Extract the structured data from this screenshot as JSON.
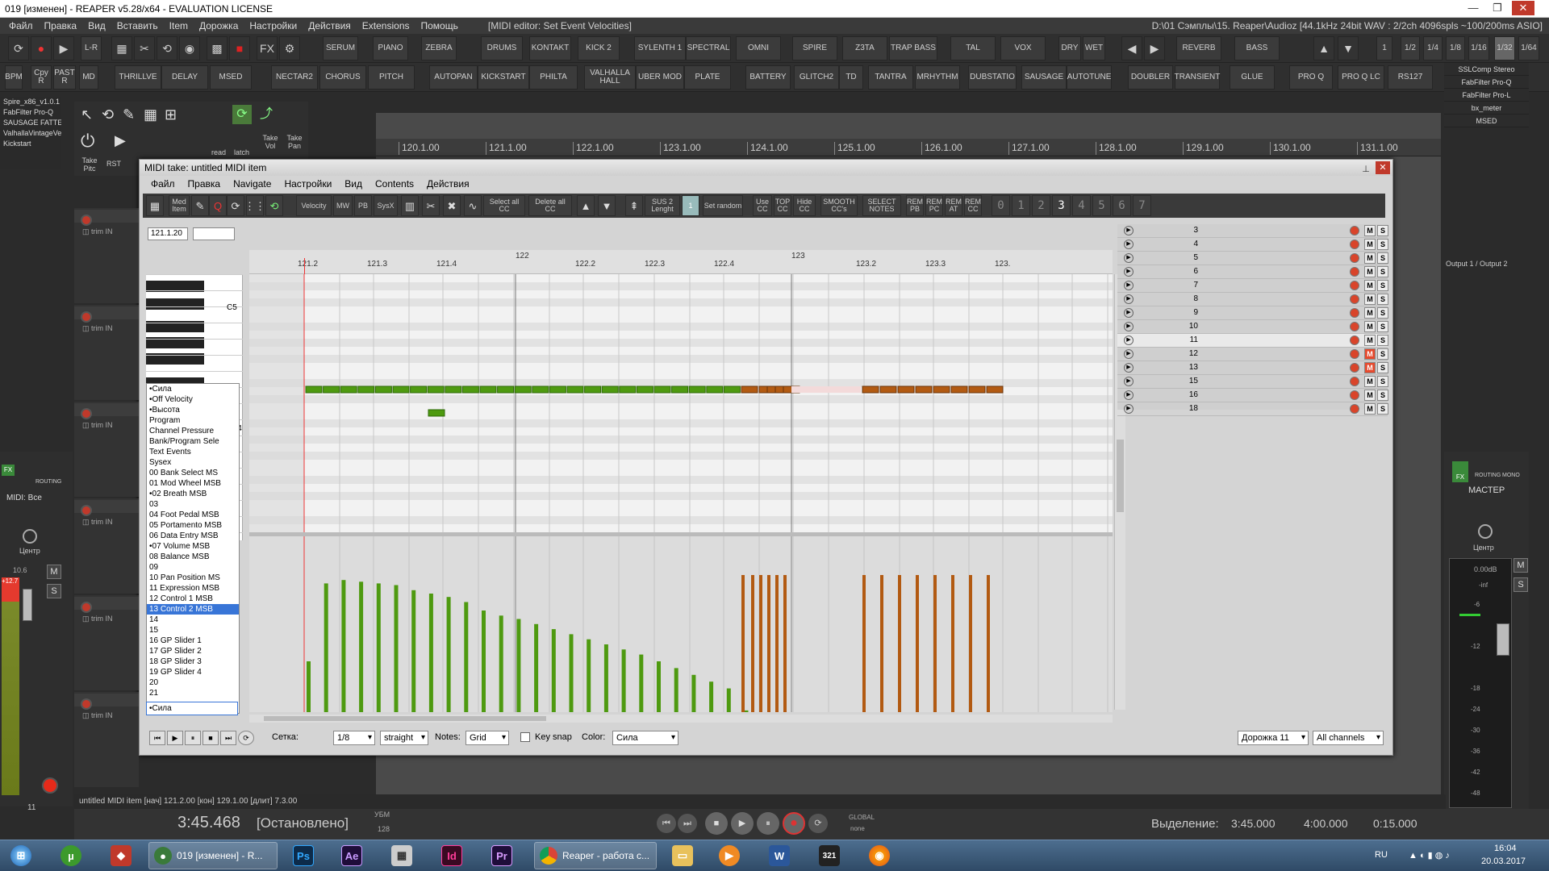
{
  "window": {
    "title": "019 [изменен] - REAPER v5.28/x64 - EVALUATION LICENSE",
    "menu": [
      "Файл",
      "Правка",
      "Вид",
      "Вставить",
      "Item",
      "Дорожка",
      "Настройки",
      "Действия",
      "Extensions",
      "Помощь"
    ],
    "editor_title": "[MIDI editor: Set Event Velocities]",
    "audio_info": "D:\\01 Сэмплы\\15. Reaper\\Audioz [44.1kHz 24bit WAV : 2/2ch 4096spls ~100/200ms ASIO]"
  },
  "toolbar1": {
    "labels": [
      "L-R",
      "SERUM",
      "PIANO",
      "ZEBRA",
      "DRUMS",
      "KONTAKT",
      "KICK 2",
      "SYLENTH 1",
      "SPECTRAL",
      "OMNI",
      "SPIRE",
      "Z3TA",
      "TRAP BASS",
      "TAL",
      "VOX",
      "DRY",
      "WET",
      "REVERB",
      "BASS",
      "1",
      "1/2",
      "1/4",
      "1/8",
      "1/16",
      "1/32",
      "1/64"
    ]
  },
  "toolbar2": {
    "labels": [
      "BPM",
      "Cpy R",
      "PAST R",
      "MD",
      "THRILLVE",
      "DELAY",
      "MSED",
      "NECTAR2",
      "CHORUS",
      "PITCH",
      "AUTOPAN",
      "KICKSTART",
      "PHILTA",
      "VALHALLA HALL",
      "UBER MOD",
      "PLATE",
      "BATTERY",
      "GLITCH2",
      "TD",
      "TANTRA",
      "MRHYTHM",
      "DUBSTATIO",
      "SAUSAGE",
      "AUTOTUNE",
      "DOUBLER",
      "TRANSIENT",
      "GLUE",
      "PRO Q",
      "PRO Q LC",
      "RS127"
    ]
  },
  "left_fx": [
    "Spire_x86_v1.0.1",
    "FabFilter Pro-Q",
    "SAUSAGE FATTE",
    "ValhallaVintageVe",
    "Kickstart"
  ],
  "right_fx": [
    "SSLComp Stereo",
    "FabFilter Pro-Q",
    "FabFilter Pro-L",
    "bx_meter",
    "MSED"
  ],
  "right_output": "Output 1 / Output 2",
  "tool3": [
    "read",
    "latch",
    "Take Vol",
    "Take Pan",
    "Take Pitc",
    "RST"
  ],
  "main_ruler": [
    "120.1.00",
    "121.1.00",
    "122.1.00",
    "123.1.00",
    "124.1.00",
    "125.1.00",
    "126.1.00",
    "127.1.00",
    "128.1.00",
    "129.1.00",
    "130.1.00",
    "131.1.00"
  ],
  "midi": {
    "title": "MIDI take: untitled MIDI item",
    "menu": [
      "Файл",
      "Правка",
      "Navigate",
      "Настройки",
      "Вид",
      "Contents",
      "Действия"
    ],
    "toolbar": [
      "Med Item",
      "Velocity",
      "MW",
      "PB",
      "SysX",
      "Select all CC",
      "Delete all CC",
      "SUS 2 Lenght",
      "1",
      "Set random",
      "Use CC",
      "TOP CC",
      "Hide CC",
      "SMOOTH CC's",
      "SELECT NOTES",
      "REM PB",
      "REM PC",
      "REM AT",
      "REM CC"
    ],
    "position": "121.1.20",
    "ruler": [
      "121.2",
      "121.3",
      "121.4",
      "122",
      "122.2",
      "122.3",
      "122.4",
      "123",
      "123.2",
      "123.3",
      "123."
    ],
    "key_label": "C5",
    "key_label2": "C4",
    "cc_list": [
      "•Сила",
      "•Off Velocity",
      "•Высота",
      "Program",
      "Channel Pressure",
      "Bank/Program Sele",
      "Text Events",
      "Sysex",
      "00 Bank Select MS",
      "01 Mod Wheel MSB",
      "•02 Breath MSB",
      "03",
      "04 Foot Pedal MSB",
      "05 Portamento MSB",
      "06 Data Entry MSB",
      "•07 Volume MSB",
      "08 Balance MSB",
      "09",
      "10 Pan Position MS",
      "11 Expression MSB",
      "12 Control 1 MSB",
      "13 Control 2 MSB",
      "14",
      "15",
      "16 GP Slider 1",
      "17 GP Slider 2",
      "18 GP Slider 3",
      "19 GP Slider 4",
      "20",
      "21"
    ],
    "cc_selected_index": 21,
    "cc_current": "•Сила",
    "tracks": [
      {
        "n": "3",
        "active": false,
        "muted": false
      },
      {
        "n": "4",
        "active": false,
        "muted": false
      },
      {
        "n": "5",
        "active": false,
        "muted": false
      },
      {
        "n": "6",
        "active": false,
        "muted": false
      },
      {
        "n": "7",
        "active": false,
        "muted": false
      },
      {
        "n": "8",
        "active": false,
        "muted": false
      },
      {
        "n": "9",
        "active": false,
        "muted": false
      },
      {
        "n": "10",
        "active": false,
        "muted": false
      },
      {
        "n": "11",
        "active": true,
        "muted": false
      },
      {
        "n": "12",
        "active": false,
        "muted": true
      },
      {
        "n": "13",
        "active": false,
        "muted": true
      },
      {
        "n": "15",
        "active": false,
        "muted": false
      },
      {
        "n": "16",
        "active": false,
        "muted": false
      },
      {
        "n": "18",
        "active": false,
        "muted": false
      }
    ],
    "m_label": "M",
    "s_label": "S",
    "bottom": {
      "grid_label": "Сетка:",
      "grid_value": "1/8",
      "swing_value": "straight",
      "notes_label": "Notes:",
      "notes_value": "Grid",
      "keysnap_label": "Key snap",
      "color_label": "Color:",
      "color_value": "Сила",
      "track_value": "Дорожка 11",
      "channel_value": "All channels"
    },
    "green_velocities": [
      30,
      76,
      78,
      77,
      76,
      75,
      72,
      70,
      68,
      65,
      60,
      57,
      55,
      52,
      49,
      46,
      43,
      40,
      37,
      34,
      30,
      26,
      22,
      18,
      14,
      1
    ],
    "orange_velocities": [
      100,
      100,
      100,
      100,
      100,
      100,
      100,
      100,
      100,
      100,
      100,
      100,
      100,
      100
    ],
    "colors": {
      "green": "#4e9a10",
      "orange": "#b25a12"
    }
  },
  "master": {
    "label": "МАСТЕР",
    "center": "Центр",
    "db": "0.00dB",
    "routing": "ROUTING",
    "mono": "MONO",
    "fx": "FX",
    "scale": [
      "-inf",
      "-6",
      "-12",
      "-18",
      "-24",
      "-30",
      "-36",
      "-42",
      "-48"
    ]
  },
  "leftmix": {
    "label": "MIDI: Все",
    "center": "Центр",
    "db": "10.6",
    "peak": "+12.7",
    "routing": "ROUTING",
    "fx": "FX",
    "num": "11"
  },
  "status": "untitled MIDI item [нач] 121.2.00 [кон] 129.1.00 [длит] 7.3.00",
  "transport": {
    "time": "3:45.468",
    "state": "[Остановлено]",
    "bpm_label": "УБМ",
    "bpm": "128",
    "selection_label": "Выделение:",
    "sel_start": "3:45.000",
    "sel_end": "4:00.000",
    "sel_len": "0:15.000",
    "global": "GLOBAL",
    "global_sub": "none"
  },
  "taskbar": {
    "apps": [
      {
        "name": "windows-start",
        "label": ""
      },
      {
        "name": "utorrent",
        "label": "µ"
      },
      {
        "name": "reaper-task",
        "label": "019 [изменен] - R..."
      },
      {
        "name": "photoshop",
        "label": "Ps"
      },
      {
        "name": "after-effects",
        "label": "Ae"
      },
      {
        "name": "calculator",
        "label": ""
      },
      {
        "name": "indesign",
        "label": "Id"
      },
      {
        "name": "premiere",
        "label": "Pr"
      },
      {
        "name": "chrome-task",
        "label": "Reaper - работа с..."
      },
      {
        "name": "explorer",
        "label": ""
      },
      {
        "name": "media-player",
        "label": ""
      },
      {
        "name": "word",
        "label": "W"
      },
      {
        "name": "media-classic",
        "label": "321"
      },
      {
        "name": "firefox",
        "label": ""
      }
    ],
    "lang": "RU",
    "time": "16:04",
    "date": "20.03.2017"
  }
}
